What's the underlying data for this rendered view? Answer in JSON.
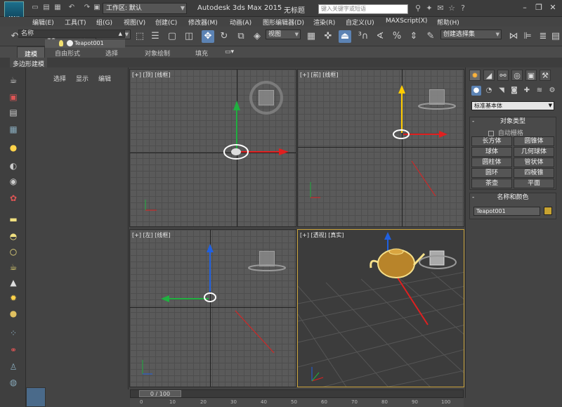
{
  "titlebar": {
    "logo": "MAX",
    "workspace_label": "工作区: 默认",
    "app_title": "Autodesk 3ds Max  2015",
    "doc_title": "无标题",
    "search_placeholder": "键入关键字或短语"
  },
  "menu": {
    "items": [
      "编辑(E)",
      "工具(T)",
      "组(G)",
      "视图(V)",
      "创建(C)",
      "修改器(M)",
      "动画(A)",
      "图形编辑器(D)",
      "渲染(R)",
      "自定义(U)",
      "MAXScript(X)",
      "帮助(H)"
    ]
  },
  "toolbar": {
    "filter_value": "全部",
    "refcoord_value": "视图",
    "named_sel_placeholder": "创建选择集"
  },
  "ribbon": {
    "tabs": [
      "建模",
      "自由形式",
      "选择",
      "对象绘制",
      "填充"
    ],
    "subtab": "多边形建模"
  },
  "explorer": {
    "tabs": [
      "选择",
      "显示",
      "编辑"
    ],
    "column_header": "名称",
    "row_label": "Teapot001"
  },
  "viewports": {
    "top": "[+] [顶] [线框]",
    "front": "[+] [前] [线框]",
    "left": "[+] [左] [线框]",
    "persp": "[+] [透视] [真实]"
  },
  "command_panel": {
    "category_value": "标准基本体",
    "object_type_title": "对象类型",
    "autogrid_label": "自动栅格",
    "object_buttons": [
      "长方体",
      "圆锥体",
      "球体",
      "几何球体",
      "圆柱体",
      "管状体",
      "圆环",
      "四棱锥",
      "茶壶",
      "平面"
    ],
    "name_color_title": "名称和颜色",
    "name_value": "Teapot001",
    "object_color": "#c8a330"
  },
  "timeline": {
    "frame_display": "0 / 100",
    "ticks": [
      "0",
      "10",
      "20",
      "30",
      "40",
      "50",
      "60",
      "70",
      "80",
      "90",
      "100"
    ]
  },
  "colors": {
    "accent_blue": "#5c83b4",
    "active_viewport_border": "#c9a23a",
    "axis_x": "#e02020",
    "axis_y": "#20b040",
    "axis_z": "#2060e0"
  }
}
